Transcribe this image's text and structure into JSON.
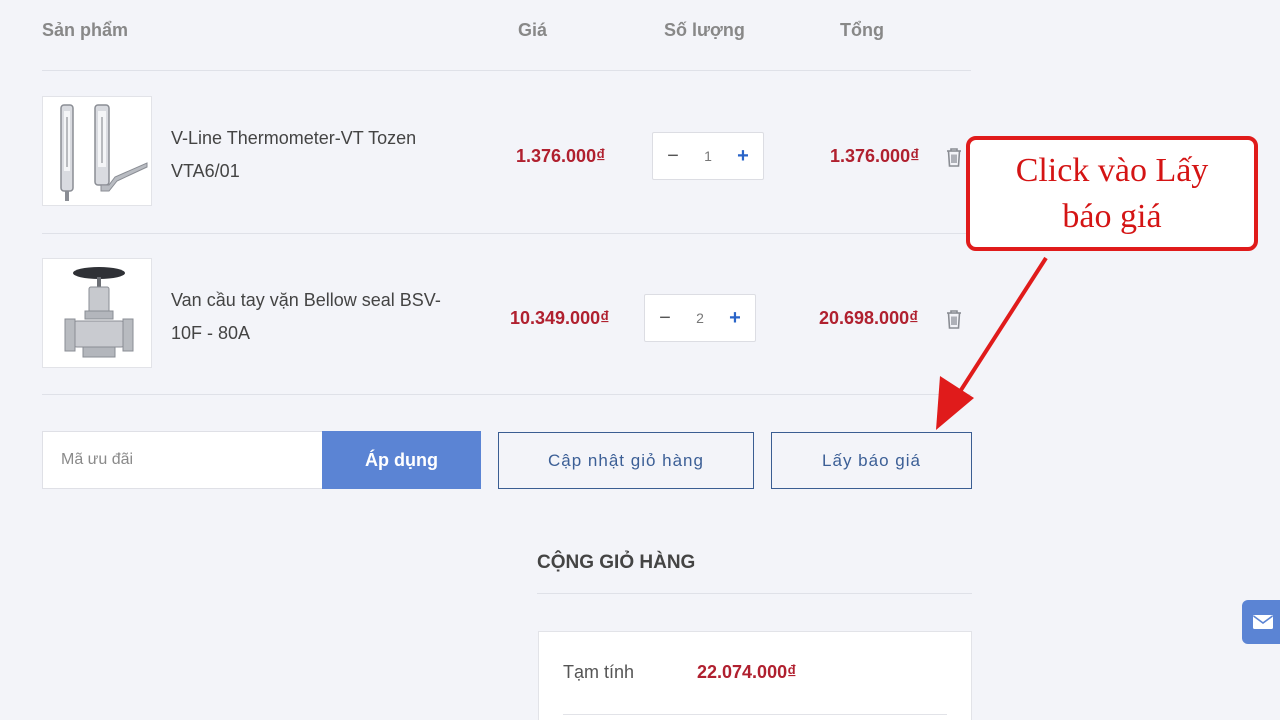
{
  "table_header": {
    "product": "Sản phẩm",
    "price": "Giá",
    "quantity": "Số lượng",
    "total": "Tổng"
  },
  "items": [
    {
      "name_line1": "V-Line Thermometer-VT Tozen",
      "name_line2": "VTA6/01",
      "price": "1.376.000₫",
      "quantity": "1",
      "total": "1.376.000₫",
      "image_icon": "thermometer-icon"
    },
    {
      "name_line1": "Van cầu tay vặn Bellow seal BSV-",
      "name_line2": "10F - 80A",
      "price": "10.349.000₫",
      "quantity": "2",
      "total": "20.698.000₫",
      "image_icon": "valve-icon"
    }
  ],
  "qty_controls": {
    "minus": "−",
    "plus": "+"
  },
  "coupon": {
    "placeholder": "Mã ưu đãi",
    "apply_label": "Áp dụng"
  },
  "actions": {
    "update_cart": "Cập nhật giỏ hàng",
    "get_quote": "Lấy báo giá"
  },
  "cart_totals": {
    "title": "CỘNG GIỎ HÀNG",
    "subtotal_label": "Tạm tính",
    "subtotal_value": "22.074.000₫"
  },
  "annotation": {
    "line1": "Click vào Lấy",
    "line2": "báo giá"
  },
  "colors": {
    "accent": "#5b84d4",
    "price": "#b0202f",
    "annotation": "#e01b1b",
    "outline_button": "#3a5d92"
  }
}
